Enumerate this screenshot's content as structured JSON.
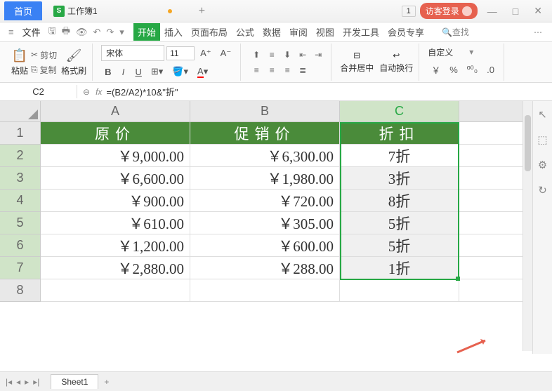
{
  "titlebar": {
    "home_tab": "首页",
    "file_icon": "S",
    "file_name": "工作簿1",
    "plus": "+",
    "page_num": "1",
    "login": "访客登录"
  },
  "menubar": {
    "file": "文件",
    "tabs": [
      "开始",
      "插入",
      "页面布局",
      "公式",
      "数据",
      "审阅",
      "视图",
      "开发工具",
      "会员专享"
    ],
    "search": "查找"
  },
  "ribbon": {
    "paste": "粘贴",
    "cut": "剪切",
    "copy": "复制",
    "format_painter": "格式刷",
    "font_name": "宋体",
    "font_size": "11",
    "merge": "合并居中",
    "wrap": "自动换行",
    "custom": "自定义"
  },
  "formula": {
    "cell_ref": "C2",
    "fx": "fx",
    "value": "=(B2/A2)*10&\"折\""
  },
  "columns": [
    "A",
    "B",
    "C"
  ],
  "rows": [
    "1",
    "2",
    "3",
    "4",
    "5",
    "6",
    "7",
    "8"
  ],
  "headers": {
    "a": "原价",
    "b": "促销价",
    "c": "折扣"
  },
  "chart_data": {
    "type": "table",
    "columns": [
      "原价",
      "促销价",
      "折扣"
    ],
    "rows": [
      {
        "a": "￥9,000.00",
        "b": "￥6,300.00",
        "c": "7折"
      },
      {
        "a": "￥6,600.00",
        "b": "￥1,980.00",
        "c": "3折"
      },
      {
        "a": "￥900.00",
        "b": "￥720.00",
        "c": "8折"
      },
      {
        "a": "￥610.00",
        "b": "￥305.00",
        "c": "5折"
      },
      {
        "a": "￥1,200.00",
        "b": "￥600.00",
        "c": "5折"
      },
      {
        "a": "￥2,880.00",
        "b": "￥288.00",
        "c": "1折"
      }
    ]
  },
  "sheet_tab": "Sheet1",
  "currency": "￥"
}
